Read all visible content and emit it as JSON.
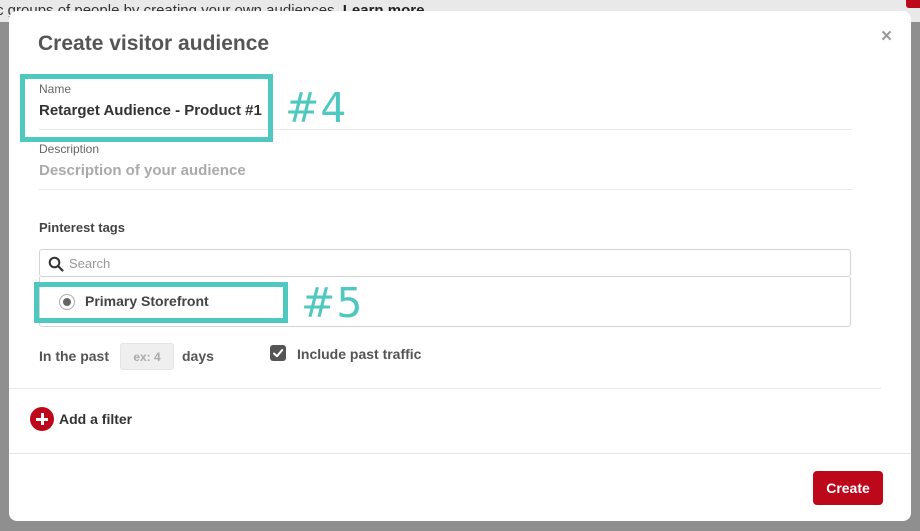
{
  "background": {
    "text": "c groups of people by creating your own audiences.",
    "link": "Learn more"
  },
  "modal": {
    "title": "Create visitor audience",
    "close_symbol": "×"
  },
  "name_field": {
    "label": "Name",
    "value": "Retarget Audience - Product #1"
  },
  "description_field": {
    "label": "Description",
    "placeholder": "Description of your audience"
  },
  "pinterest_tags": {
    "label": "Pinterest tags",
    "search_placeholder": "Search",
    "items": [
      {
        "label": "Primary Storefront",
        "selected": true
      }
    ]
  },
  "lookback": {
    "prefix": "In the past",
    "placeholder": "ex: 4",
    "suffix": "days"
  },
  "include_past_traffic": {
    "label": "Include past traffic",
    "checked": true
  },
  "add_filter": {
    "label": "Add a filter"
  },
  "footer": {
    "create_label": "Create"
  },
  "annotations": {
    "step_4": "#4",
    "step_5": "#5"
  },
  "colors": {
    "accent_red": "#bd081c",
    "annotation_teal": "#4fc8c0"
  }
}
